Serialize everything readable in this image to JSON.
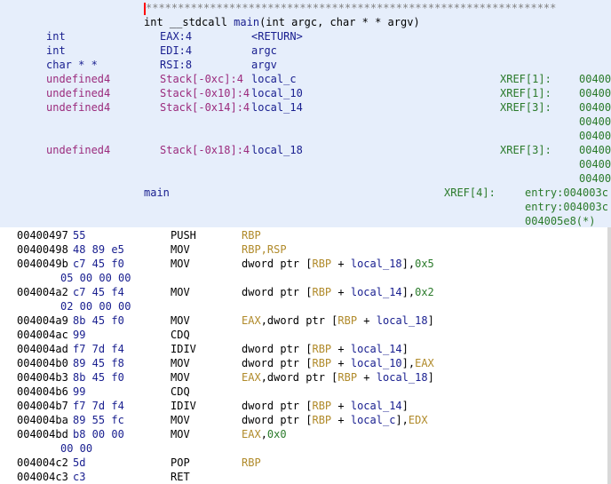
{
  "header": {
    "stars": "****************************************************************",
    "signature_parts": [
      "int __stdcall ",
      "main",
      "(int argc, char * * argv)"
    ],
    "params": [
      {
        "type": "int",
        "storage": "EAX:4",
        "name": "<RETURN>",
        "xref": "",
        "xaddrs": []
      },
      {
        "type": "int",
        "storage": "EDI:4",
        "name": "argc",
        "xref": "",
        "xaddrs": []
      },
      {
        "type": "char * *",
        "storage": "RSI:8",
        "name": "argv",
        "xref": "",
        "xaddrs": []
      },
      {
        "type": "undefined4",
        "storage": "Stack[-0xc]:4",
        "name": "local_c",
        "xref": "XREF[1]:",
        "xaddrs": [
          "00400"
        ]
      },
      {
        "type": "undefined4",
        "storage": "Stack[-0x10]:4",
        "name": "local_10",
        "xref": "XREF[1]:",
        "xaddrs": [
          "00400"
        ]
      },
      {
        "type": "undefined4",
        "storage": "Stack[-0x14]:4",
        "name": "local_14",
        "xref": "XREF[3]:",
        "xaddrs": [
          "00400",
          "00400",
          "00400"
        ]
      },
      {
        "type": "undefined4",
        "storage": "Stack[-0x18]:4",
        "name": "local_18",
        "xref": "XREF[3]:",
        "xaddrs": [
          "00400",
          "00400",
          "00400"
        ]
      }
    ],
    "function_label": "main",
    "label_xref": "XREF[4]:",
    "label_xref_entries": [
      "entry:004003c",
      "entry:004003c",
      "004005e8(*)"
    ]
  },
  "instructions": [
    {
      "addr": "00400497",
      "bytes": "55",
      "mnemonic": "PUSH",
      "operands": [
        {
          "t": "RBP",
          "k": "reg"
        }
      ]
    },
    {
      "addr": "00400498",
      "bytes": "48 89 e5",
      "mnemonic": "MOV",
      "operands": [
        {
          "t": "RBP,RSP",
          "k": "reg"
        }
      ]
    },
    {
      "addr": "0040049b",
      "bytes": "c7 45 f0",
      "mnemonic": "MOV",
      "operands": [
        {
          "t": "dword ptr [",
          "k": "plain"
        },
        {
          "t": "RBP",
          "k": "reg"
        },
        {
          "t": " + ",
          "k": "plain"
        },
        {
          "t": "local_18",
          "k": "local"
        },
        {
          "t": "],",
          "k": "plain"
        },
        {
          "t": "0x5",
          "k": "num"
        }
      ]
    },
    {
      "addr": "",
      "bytes": "05 00 00 00",
      "mnemonic": "",
      "operands": []
    },
    {
      "addr": "004004a2",
      "bytes": "c7 45 f4",
      "mnemonic": "MOV",
      "operands": [
        {
          "t": "dword ptr [",
          "k": "plain"
        },
        {
          "t": "RBP",
          "k": "reg"
        },
        {
          "t": " + ",
          "k": "plain"
        },
        {
          "t": "local_14",
          "k": "local"
        },
        {
          "t": "],",
          "k": "plain"
        },
        {
          "t": "0x2",
          "k": "num"
        }
      ]
    },
    {
      "addr": "",
      "bytes": "02 00 00 00",
      "mnemonic": "",
      "operands": []
    },
    {
      "addr": "004004a9",
      "bytes": "8b 45 f0",
      "mnemonic": "MOV",
      "operands": [
        {
          "t": "EAX",
          "k": "reg"
        },
        {
          "t": ",dword ptr [",
          "k": "plain"
        },
        {
          "t": "RBP",
          "k": "reg"
        },
        {
          "t": " + ",
          "k": "plain"
        },
        {
          "t": "local_18",
          "k": "local"
        },
        {
          "t": "]",
          "k": "plain"
        }
      ]
    },
    {
      "addr": "004004ac",
      "bytes": "99",
      "mnemonic": "CDQ",
      "operands": []
    },
    {
      "addr": "004004ad",
      "bytes": "f7 7d f4",
      "mnemonic": "IDIV",
      "operands": [
        {
          "t": "dword ptr [",
          "k": "plain"
        },
        {
          "t": "RBP",
          "k": "reg"
        },
        {
          "t": " + ",
          "k": "plain"
        },
        {
          "t": "local_14",
          "k": "local"
        },
        {
          "t": "]",
          "k": "plain"
        }
      ]
    },
    {
      "addr": "004004b0",
      "bytes": "89 45 f8",
      "mnemonic": "MOV",
      "operands": [
        {
          "t": "dword ptr [",
          "k": "plain"
        },
        {
          "t": "RBP",
          "k": "reg"
        },
        {
          "t": " + ",
          "k": "plain"
        },
        {
          "t": "local_10",
          "k": "local"
        },
        {
          "t": "],",
          "k": "plain"
        },
        {
          "t": "EAX",
          "k": "reg"
        }
      ]
    },
    {
      "addr": "004004b3",
      "bytes": "8b 45 f0",
      "mnemonic": "MOV",
      "operands": [
        {
          "t": "EAX",
          "k": "reg"
        },
        {
          "t": ",dword ptr [",
          "k": "plain"
        },
        {
          "t": "RBP",
          "k": "reg"
        },
        {
          "t": " + ",
          "k": "plain"
        },
        {
          "t": "local_18",
          "k": "local"
        },
        {
          "t": "]",
          "k": "plain"
        }
      ]
    },
    {
      "addr": "004004b6",
      "bytes": "99",
      "mnemonic": "CDQ",
      "operands": []
    },
    {
      "addr": "004004b7",
      "bytes": "f7 7d f4",
      "mnemonic": "IDIV",
      "operands": [
        {
          "t": "dword ptr [",
          "k": "plain"
        },
        {
          "t": "RBP",
          "k": "reg"
        },
        {
          "t": " + ",
          "k": "plain"
        },
        {
          "t": "local_14",
          "k": "local"
        },
        {
          "t": "]",
          "k": "plain"
        }
      ]
    },
    {
      "addr": "004004ba",
      "bytes": "89 55 fc",
      "mnemonic": "MOV",
      "operands": [
        {
          "t": "dword ptr [",
          "k": "plain"
        },
        {
          "t": "RBP",
          "k": "reg"
        },
        {
          "t": " + ",
          "k": "plain"
        },
        {
          "t": "local_c",
          "k": "local"
        },
        {
          "t": "],",
          "k": "plain"
        },
        {
          "t": "EDX",
          "k": "reg"
        }
      ]
    },
    {
      "addr": "004004bd",
      "bytes": "b8 00 00",
      "mnemonic": "MOV",
      "operands": [
        {
          "t": "EAX",
          "k": "reg"
        },
        {
          "t": ",",
          "k": "plain"
        },
        {
          "t": "0x0",
          "k": "num"
        }
      ]
    },
    {
      "addr": "",
      "bytes": "00 00",
      "mnemonic": "",
      "operands": []
    },
    {
      "addr": "004004c2",
      "bytes": "5d",
      "mnemonic": "POP",
      "operands": [
        {
          "t": "RBP",
          "k": "reg"
        }
      ]
    },
    {
      "addr": "004004c3",
      "bytes": "c3",
      "mnemonic": "RET",
      "operands": []
    }
  ]
}
